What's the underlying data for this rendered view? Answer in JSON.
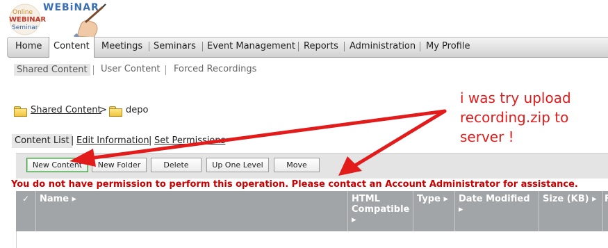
{
  "logo": {
    "text": "WEBiNAR",
    "badge": [
      "Online",
      "WEBINAR",
      "Seminar"
    ]
  },
  "nav": {
    "items": [
      {
        "label": "Home"
      },
      {
        "label": "Content"
      },
      {
        "label": "Meetings"
      },
      {
        "label": "Seminars"
      },
      {
        "label": "Event Management"
      },
      {
        "label": "Reports"
      },
      {
        "label": "Administration"
      },
      {
        "label": "My Profile"
      }
    ],
    "active": "Content"
  },
  "subnav": {
    "items": [
      {
        "label": "Shared Content"
      },
      {
        "label": "User Content"
      },
      {
        "label": "Forced Recordings"
      }
    ],
    "active": "Shared Content"
  },
  "breadcrumb": {
    "root": "Shared Content",
    "separator": ">",
    "current": "depo"
  },
  "content_tabs": {
    "items": [
      {
        "label": "Content List"
      },
      {
        "label": "Edit Information"
      },
      {
        "label": "Set Permissions"
      }
    ],
    "separator": "|"
  },
  "toolbar": {
    "buttons": [
      {
        "label": "New Content"
      },
      {
        "label": "New Folder"
      },
      {
        "label": "Delete"
      },
      {
        "label": "Up One Level"
      },
      {
        "label": "Move"
      }
    ]
  },
  "error": "You do not have permission to perform this operation. Please contact an Account Administrator for assistance.",
  "table": {
    "check_glyph": "✓",
    "columns": [
      {
        "label": "Name"
      },
      {
        "label": "HTML Compatible"
      },
      {
        "label": "Type"
      },
      {
        "label": "Date Modified"
      },
      {
        "label": "Size (KB)"
      },
      {
        "label": "F"
      }
    ],
    "sort_glyph": "▸"
  },
  "annotation": "i was try upload\nrecording.zip to\nserver !",
  "colors": {
    "annotation": "#e21b1b",
    "error": "#cc0000",
    "table_header": "#a2a5a7"
  }
}
